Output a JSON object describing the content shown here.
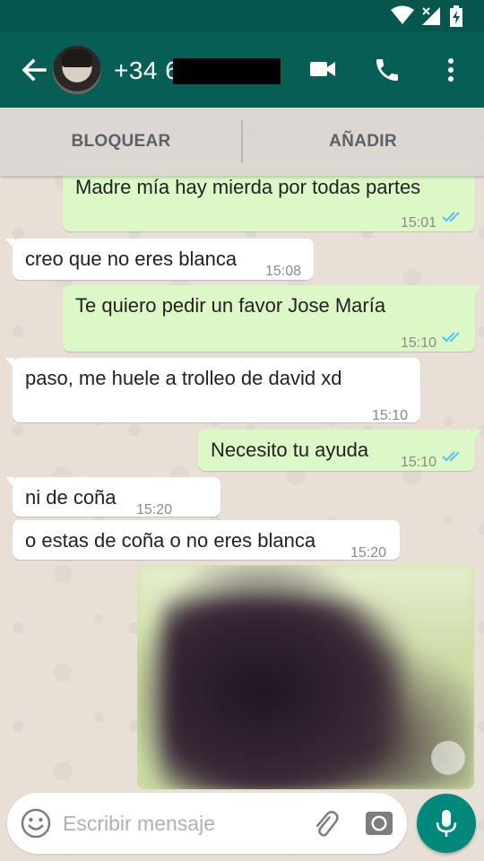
{
  "header": {
    "contact_name": "+34 6",
    "icons": [
      "back-arrow-icon",
      "video-call-icon",
      "phone-icon",
      "more-vert-icon"
    ]
  },
  "status_bar": {
    "icons": [
      "wifi-icon",
      "signal-icon",
      "battery-charging-icon"
    ]
  },
  "actions": {
    "block_label": "BLOQUEAR",
    "add_label": "AÑADIR"
  },
  "messages": [
    {
      "direction": "out",
      "text": "Madre mía hay mierda por todas partes",
      "time": "15:01",
      "read": true
    },
    {
      "direction": "in",
      "text": "creo que no eres blanca",
      "time": "15:08"
    },
    {
      "direction": "out",
      "text": "Te quiero pedir un favor Jose María",
      "time": "15:10",
      "read": true
    },
    {
      "direction": "in",
      "text": "paso, me huele a trolleo de david xd",
      "time": "15:10"
    },
    {
      "direction": "out",
      "text": "Necesito tu ayuda",
      "time": "15:10",
      "read": true
    },
    {
      "direction": "in",
      "text": "ni de coña",
      "time": "15:20"
    },
    {
      "direction": "in",
      "text": "o estas de coña o no eres blanca",
      "time": "15:20"
    }
  ],
  "composer": {
    "placeholder": "Escribir mensaje",
    "icons": [
      "emoji-icon",
      "attach-icon",
      "camera-icon",
      "mic-icon"
    ]
  },
  "colors": {
    "header": "#075e54",
    "status_bar": "#05564c",
    "outgoing_bubble": "#dcf8c6",
    "incoming_bubble": "#ffffff",
    "read_ticks": "#4fc3f7",
    "fab": "#00897b"
  }
}
